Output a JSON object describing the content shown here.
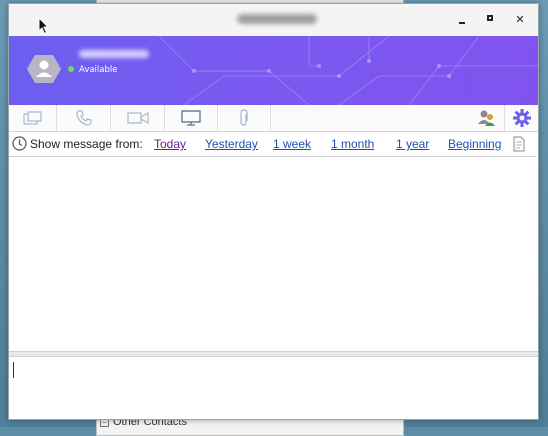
{
  "window": {
    "controls": {
      "minimize_icon": "minimize-icon",
      "maximize_icon": "maximize-icon",
      "close_icon": "close-icon",
      "close_glyph": "✕"
    }
  },
  "profile": {
    "status": "Available",
    "status_color": "#6cd96a",
    "banner_color": "#7a59f0"
  },
  "toolbar": {
    "items": [
      "chat-icon",
      "phone-icon",
      "video-icon",
      "screen-share-icon",
      "attach-icon",
      "contacts-icon",
      "gear-icon"
    ],
    "accent": "#6b5ff0"
  },
  "history": {
    "label": "Show message from:",
    "links": [
      "Today",
      "Yesterday",
      "1 week",
      "1 month",
      "1 year",
      "Beginning"
    ],
    "active_link": "Today",
    "link_color": "#1f4fb3"
  },
  "background": {
    "group_label": "Other Contacts",
    "group_toggle": "−"
  }
}
